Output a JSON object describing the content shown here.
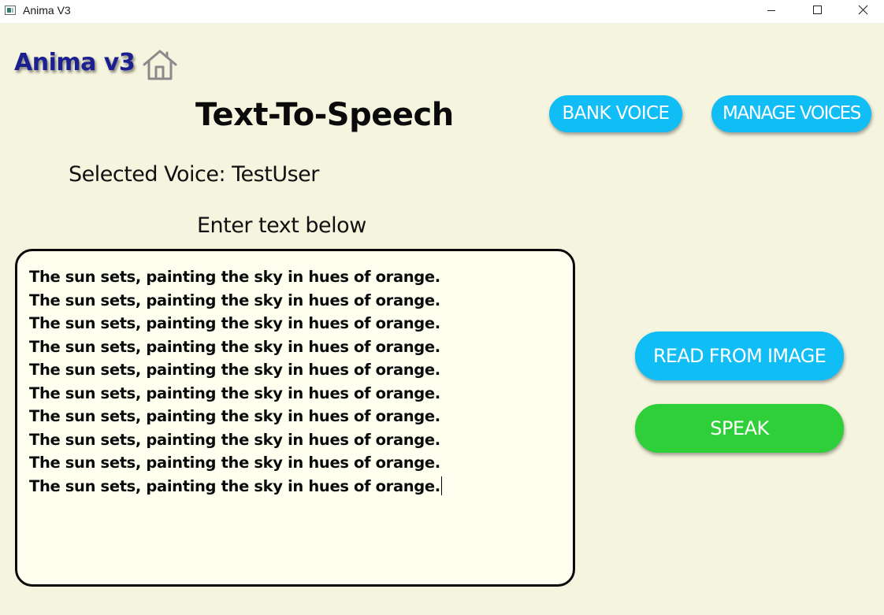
{
  "window": {
    "title": "Anima V3"
  },
  "header": {
    "brand": "Anima v3",
    "home_icon": "home-icon",
    "title": "Text-To-Speech"
  },
  "actions": {
    "bank_voice": "BANK VOICE",
    "manage_voices": "MANAGE VOICES",
    "read_from_image": "READ FROM IMAGE",
    "speak": "SPEAK"
  },
  "voice": {
    "selected_label": "Selected Voice: TestUser"
  },
  "input": {
    "label": "Enter text below",
    "lines": [
      "The sun sets, painting the sky in hues of orange.",
      "The sun sets, painting the sky in hues of orange.",
      "The sun sets, painting the sky in hues of orange.",
      "The sun sets, painting the sky in hues of orange.",
      "The sun sets, painting the sky in hues of orange.",
      "The sun sets, painting the sky in hues of orange.",
      "The sun sets, painting the sky in hues of orange.",
      "The sun sets, painting the sky in hues of orange.",
      "The sun sets, painting the sky in hues of orange.",
      "The sun sets, painting the sky in hues of orange."
    ]
  },
  "colors": {
    "background": "#f5f4df",
    "primary_button": "#11bdf5",
    "speak_button": "#2fcf3a",
    "brand": "#1b1f8f",
    "textbox_background": "#fffff0"
  }
}
